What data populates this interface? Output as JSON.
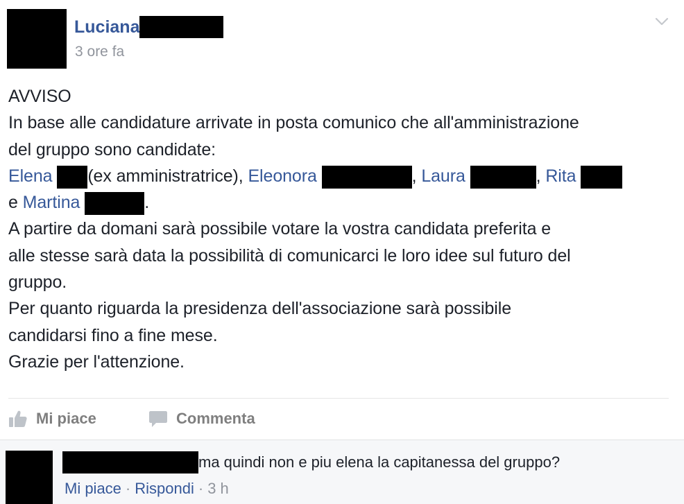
{
  "post": {
    "author_name": "Luciana",
    "timestamp": "3 ore fa",
    "body": {
      "line1": "AVVISO",
      "line2": "In base alle candidature arrivate in posta comunico che all'amministrazione",
      "line3": "del gruppo sono candidate:",
      "line4": {
        "elena": "Elena",
        "elena_note": "(ex amministratrice), ",
        "eleonora": "Eleonora",
        "sep1": ", ",
        "laura": "Laura",
        "sep2": ", ",
        "rita": "Rita"
      },
      "line5": {
        "prefix": "e ",
        "martina": "Martina",
        "suffix": "."
      },
      "line6": "A partire da domani sarà possibile votare la vostra candidata preferita e",
      "line7": "alle stesse sarà data la possibilità di comunicarci le loro idee sul futuro del",
      "line8": "gruppo.",
      "line9": "Per quanto riguarda la presidenza dell'associazione sarà possibile",
      "line10": "candidarsi fino a fine mese.",
      "line11": "Grazie per l'attenzione."
    }
  },
  "actions": {
    "like_label": "Mi piace",
    "comment_label": "Commenta"
  },
  "comment": {
    "text": "ma quindi non e piu elena la capitanessa del gruppo?",
    "like_label": "Mi piace",
    "separator": "·",
    "reply_label": "Rispondi",
    "time": "3 h"
  },
  "colors": {
    "link": "#365899",
    "muted": "#90949c",
    "action_gray": "#7f7f7f",
    "text": "#1d2129",
    "comment_bg": "#f6f7f9"
  },
  "icons": {
    "chevron": "chevron-down-icon",
    "like": "thumbs-up-icon",
    "comment": "speech-bubble-icon"
  }
}
